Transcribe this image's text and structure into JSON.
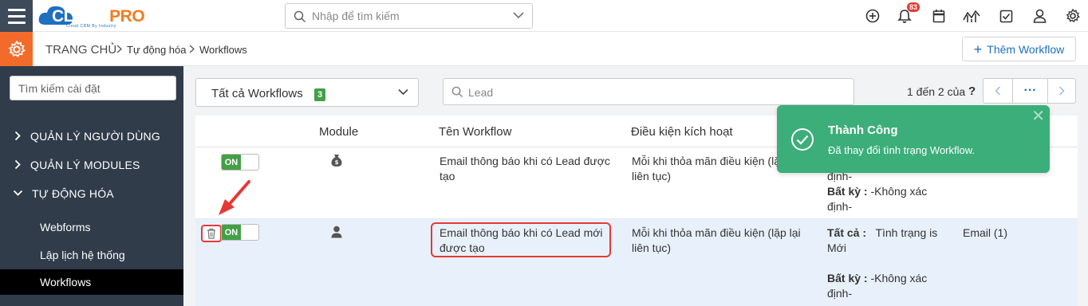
{
  "header": {
    "logo": {
      "part1": "CLOUD",
      "part2": "PRO",
      "tagline": "Cloud CRM By Industry"
    },
    "search_placeholder": "Nhập để tìm kiếm",
    "notification_count": "83",
    "icons": [
      "plus-circle-icon",
      "bell-icon",
      "calendar-icon",
      "chart-icon",
      "checkbox-icon",
      "user-icon",
      "gear-icon"
    ]
  },
  "breadcrumb": {
    "home": "TRANG CHỦ",
    "level1": "Tự động hóa",
    "level2": "Workflows"
  },
  "actions": {
    "add_workflow": "Thêm Workflow"
  },
  "sidebar": {
    "search_placeholder": "Tìm kiếm cài đặt",
    "groups": [
      {
        "label": "QUẢN LÝ NGƯỜI DÙNG",
        "expanded": false
      },
      {
        "label": "QUẢN LÝ MODULES",
        "expanded": false
      },
      {
        "label": "TỰ ĐỘNG HÓA",
        "expanded": true
      }
    ],
    "subitems": [
      {
        "label": "Webforms",
        "active": false
      },
      {
        "label": "Lập lịch hệ thống",
        "active": false
      },
      {
        "label": "Workflows",
        "active": true
      }
    ]
  },
  "filter": {
    "label": "Tất cả Workflows",
    "count": "3"
  },
  "list_search": {
    "value": "Lead"
  },
  "pagination": {
    "text": "1 đến 2 của",
    "unknown": "?",
    "more": "···"
  },
  "table": {
    "headers": {
      "module": "Module",
      "name": "Tên Workflow",
      "trigger": "Điều kiện kích hoạt"
    },
    "rows": [
      {
        "status": "ON",
        "module_icon": "money-bag-icon",
        "name_line1": "Email thông báo khi có Lead được",
        "name_line2": "tạo",
        "trigger_line1": "Mỗi khi thỏa mãn điều kiện (lặp lại",
        "trigger_line2": "liên tục)",
        "cond_any_tail": "định-",
        "cond_any_label": "Bất kỳ :",
        "cond_any_value": "-Không xác",
        "cond_any_value2": "định-"
      },
      {
        "status": "ON",
        "module_icon": "person-icon",
        "name_line1": "Email thông báo khi có Lead mới",
        "name_line2": "được tạo",
        "trigger_line1": "Mỗi khi thỏa mãn điều kiện (lặp lại",
        "trigger_line2": "liên tục)",
        "cond_all_label": "Tất cả :",
        "cond_all_value": "Tình trạng is",
        "cond_all_value2": "Mới",
        "cond_any_label": "Bất kỳ :",
        "cond_any_value": "-Không xác",
        "cond_any_value2": "định-",
        "action": "Email (1)"
      }
    ]
  },
  "toast": {
    "title": "Thành Công",
    "message": "Đã thay đổi tình trạng Workflow.",
    "color": "#3bae7a"
  },
  "colors": {
    "accent": "#1e6fc0",
    "sidebar": "#303c4a",
    "settings": "#f26b2a",
    "on": "#43a047",
    "annotation": "#e53935"
  }
}
